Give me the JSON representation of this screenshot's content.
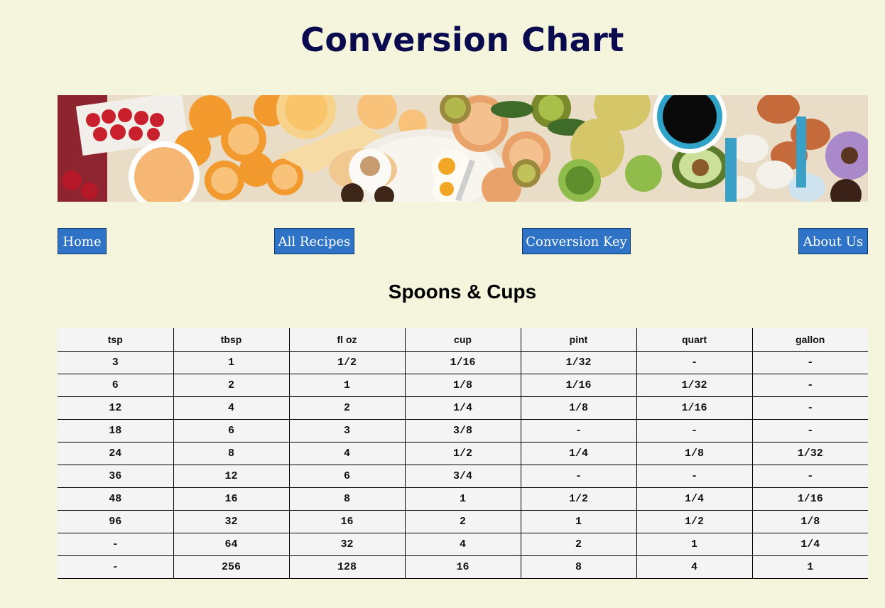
{
  "page": {
    "title": "Conversion Chart",
    "background": "#f5f4dc",
    "title_color": "#0a0a4e"
  },
  "banner": {
    "description_icon": "food-photo-banner"
  },
  "nav": {
    "accent": "#2f73c6",
    "items": [
      {
        "label": "Home"
      },
      {
        "label": "All Recipes"
      },
      {
        "label": "Conversion Key"
      },
      {
        "label": "About Us"
      }
    ]
  },
  "section": {
    "title": "Spoons & Cups"
  },
  "table": {
    "headers": [
      "tsp",
      "tbsp",
      "fl oz",
      "cup",
      "pint",
      "quart",
      "gallon"
    ],
    "rows": [
      [
        "3",
        "1",
        "1/2",
        "1/16",
        "1/32",
        "-",
        "-"
      ],
      [
        "6",
        "2",
        "1",
        "1/8",
        "1/16",
        "1/32",
        "-"
      ],
      [
        "12",
        "4",
        "2",
        "1/4",
        "1/8",
        "1/16",
        "-"
      ],
      [
        "18",
        "6",
        "3",
        "3/8",
        "-",
        "-",
        "-"
      ],
      [
        "24",
        "8",
        "4",
        "1/2",
        "1/4",
        "1/8",
        "1/32"
      ],
      [
        "36",
        "12",
        "6",
        "3/4",
        "-",
        "-",
        "-"
      ],
      [
        "48",
        "16",
        "8",
        "1",
        "1/2",
        "1/4",
        "1/16"
      ],
      [
        "96",
        "32",
        "16",
        "2",
        "1",
        "1/2",
        "1/8"
      ],
      [
        "-",
        "64",
        "32",
        "4",
        "2",
        "1",
        "1/4"
      ],
      [
        "-",
        "256",
        "128",
        "16",
        "8",
        "4",
        "1"
      ]
    ]
  }
}
